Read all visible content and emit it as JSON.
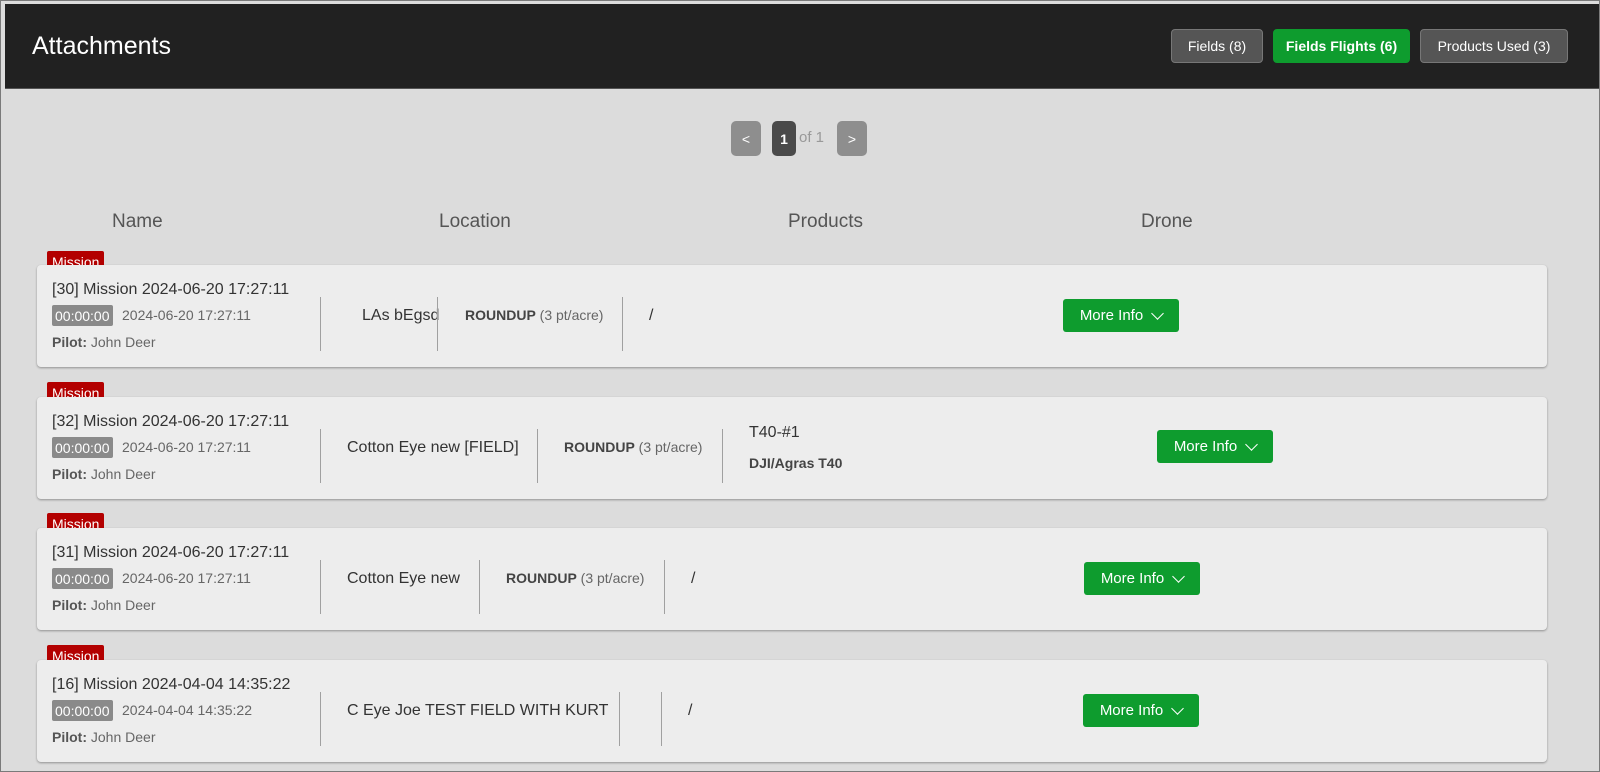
{
  "header": {
    "title": "Attachments",
    "tabs": [
      {
        "label": "Fields (8)",
        "active": false
      },
      {
        "label": "Fields Flights (6)",
        "active": true
      },
      {
        "label": "Products Used (3)",
        "active": false
      }
    ]
  },
  "pager": {
    "prev": "<",
    "current": "1",
    "of_text": "of 1",
    "next": ">"
  },
  "columns": {
    "name": "Name",
    "location": "Location",
    "products": "Products",
    "drone": "Drone"
  },
  "colors": {
    "accent_green": "#0e9c2e",
    "mission_red": "#b30000",
    "header_bg": "#212121"
  },
  "icons": {
    "more_info": "chevron-down-icon"
  },
  "missions": [
    {
      "badge": "Mission",
      "name": "[30] Mission 2024-06-20 17:27:11",
      "duration": "00:00:00",
      "date": "2024-06-20 17:27:11",
      "pilot_label": "Pilot:",
      "pilot": "John Deer",
      "location": "LAs bEgsd",
      "product_name": "ROUNDUP",
      "product_rate": "(3 pt/acre)",
      "drone": "/",
      "drone_model": "",
      "more_info": "More Info"
    },
    {
      "badge": "Mission",
      "name": "[32] Mission 2024-06-20 17:27:11",
      "duration": "00:00:00",
      "date": "2024-06-20 17:27:11",
      "pilot_label": "Pilot:",
      "pilot": "John Deer",
      "location": "Cotton Eye new [FIELD]",
      "product_name": "ROUNDUP",
      "product_rate": "(3 pt/acre)",
      "drone": "T40-#1",
      "drone_model": "DJI/Agras T40",
      "more_info": "More Info"
    },
    {
      "badge": "Mission",
      "name": "[31] Mission 2024-06-20 17:27:11",
      "duration": "00:00:00",
      "date": "2024-06-20 17:27:11",
      "pilot_label": "Pilot:",
      "pilot": "John Deer",
      "location": "Cotton Eye new",
      "product_name": "ROUNDUP",
      "product_rate": "(3 pt/acre)",
      "drone": "/",
      "drone_model": "",
      "more_info": "More Info"
    },
    {
      "badge": "Mission",
      "name": "[16] Mission 2024-04-04 14:35:22",
      "duration": "00:00:00",
      "date": "2024-04-04 14:35:22",
      "pilot_label": "Pilot:",
      "pilot": "John Deer",
      "location": "C Eye Joe TEST FIELD WITH KURT",
      "product_name": "",
      "product_rate": "",
      "drone": "/",
      "drone_model": "",
      "more_info": "More Info"
    }
  ]
}
